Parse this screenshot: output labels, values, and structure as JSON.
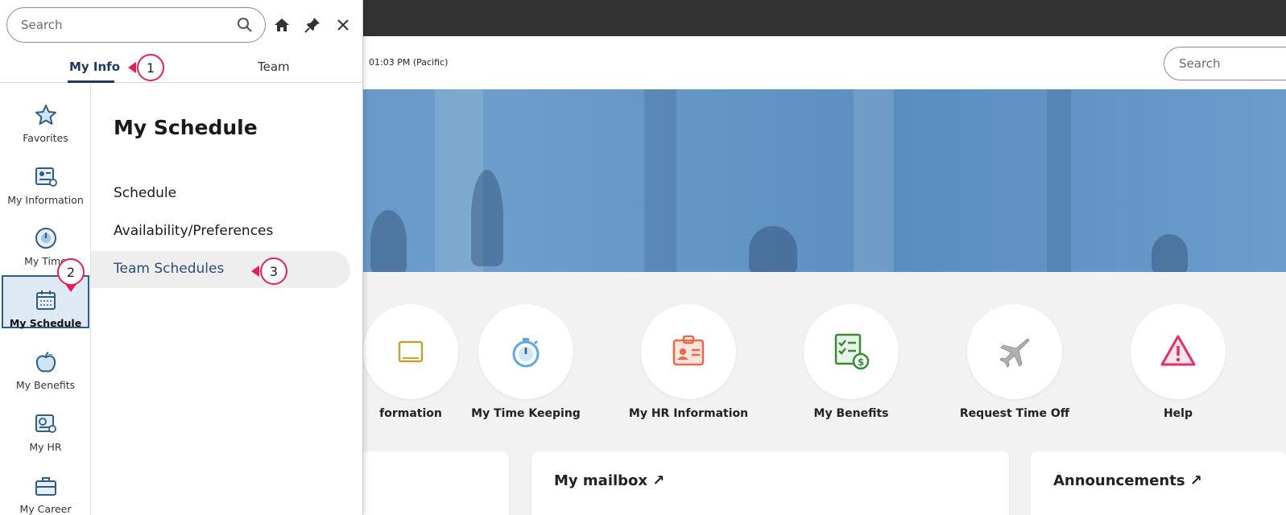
{
  "app": {
    "time_text": "01:03 PM (Pacific)",
    "search_placeholder": "Search"
  },
  "tiles": [
    {
      "label": "formation",
      "icon": "information-icon"
    },
    {
      "label": "My Time Keeping",
      "icon": "stopwatch-icon"
    },
    {
      "label": "My HR Information",
      "icon": "id-badge-icon"
    },
    {
      "label": "My Benefits",
      "icon": "benefits-checklist-icon"
    },
    {
      "label": "Request Time Off",
      "icon": "airplane-icon"
    },
    {
      "label": "Help",
      "icon": "warning-icon"
    }
  ],
  "cards": {
    "mailbox_title": "My mailbox ↗",
    "announcements_title": "Announcements ↗"
  },
  "panel": {
    "search_placeholder": "Search",
    "tabs": [
      {
        "label": "My Info",
        "active": true
      },
      {
        "label": "Team",
        "active": false
      }
    ],
    "rail": [
      {
        "label": "Favorites",
        "icon": "star-icon"
      },
      {
        "label": "My Information",
        "icon": "profile-card-icon"
      },
      {
        "label": "My Time",
        "icon": "clock-icon"
      },
      {
        "label": "My Schedule",
        "icon": "calendar-icon",
        "active": true
      },
      {
        "label": "My Benefits",
        "icon": "apple-icon"
      },
      {
        "label": "My HR",
        "icon": "hr-document-icon"
      },
      {
        "label": "My Career",
        "icon": "briefcase-icon"
      }
    ],
    "section_title": "My Schedule",
    "links": [
      {
        "label": "Schedule"
      },
      {
        "label": "Availability/Preferences"
      },
      {
        "label": "Team Schedules",
        "highlighted": true
      }
    ]
  },
  "callouts": {
    "one": "1",
    "two": "2",
    "three": "3"
  },
  "colors": {
    "callout": "#e0205a",
    "active_accent": "#2f5d86",
    "hero": "#6a9ccc"
  }
}
